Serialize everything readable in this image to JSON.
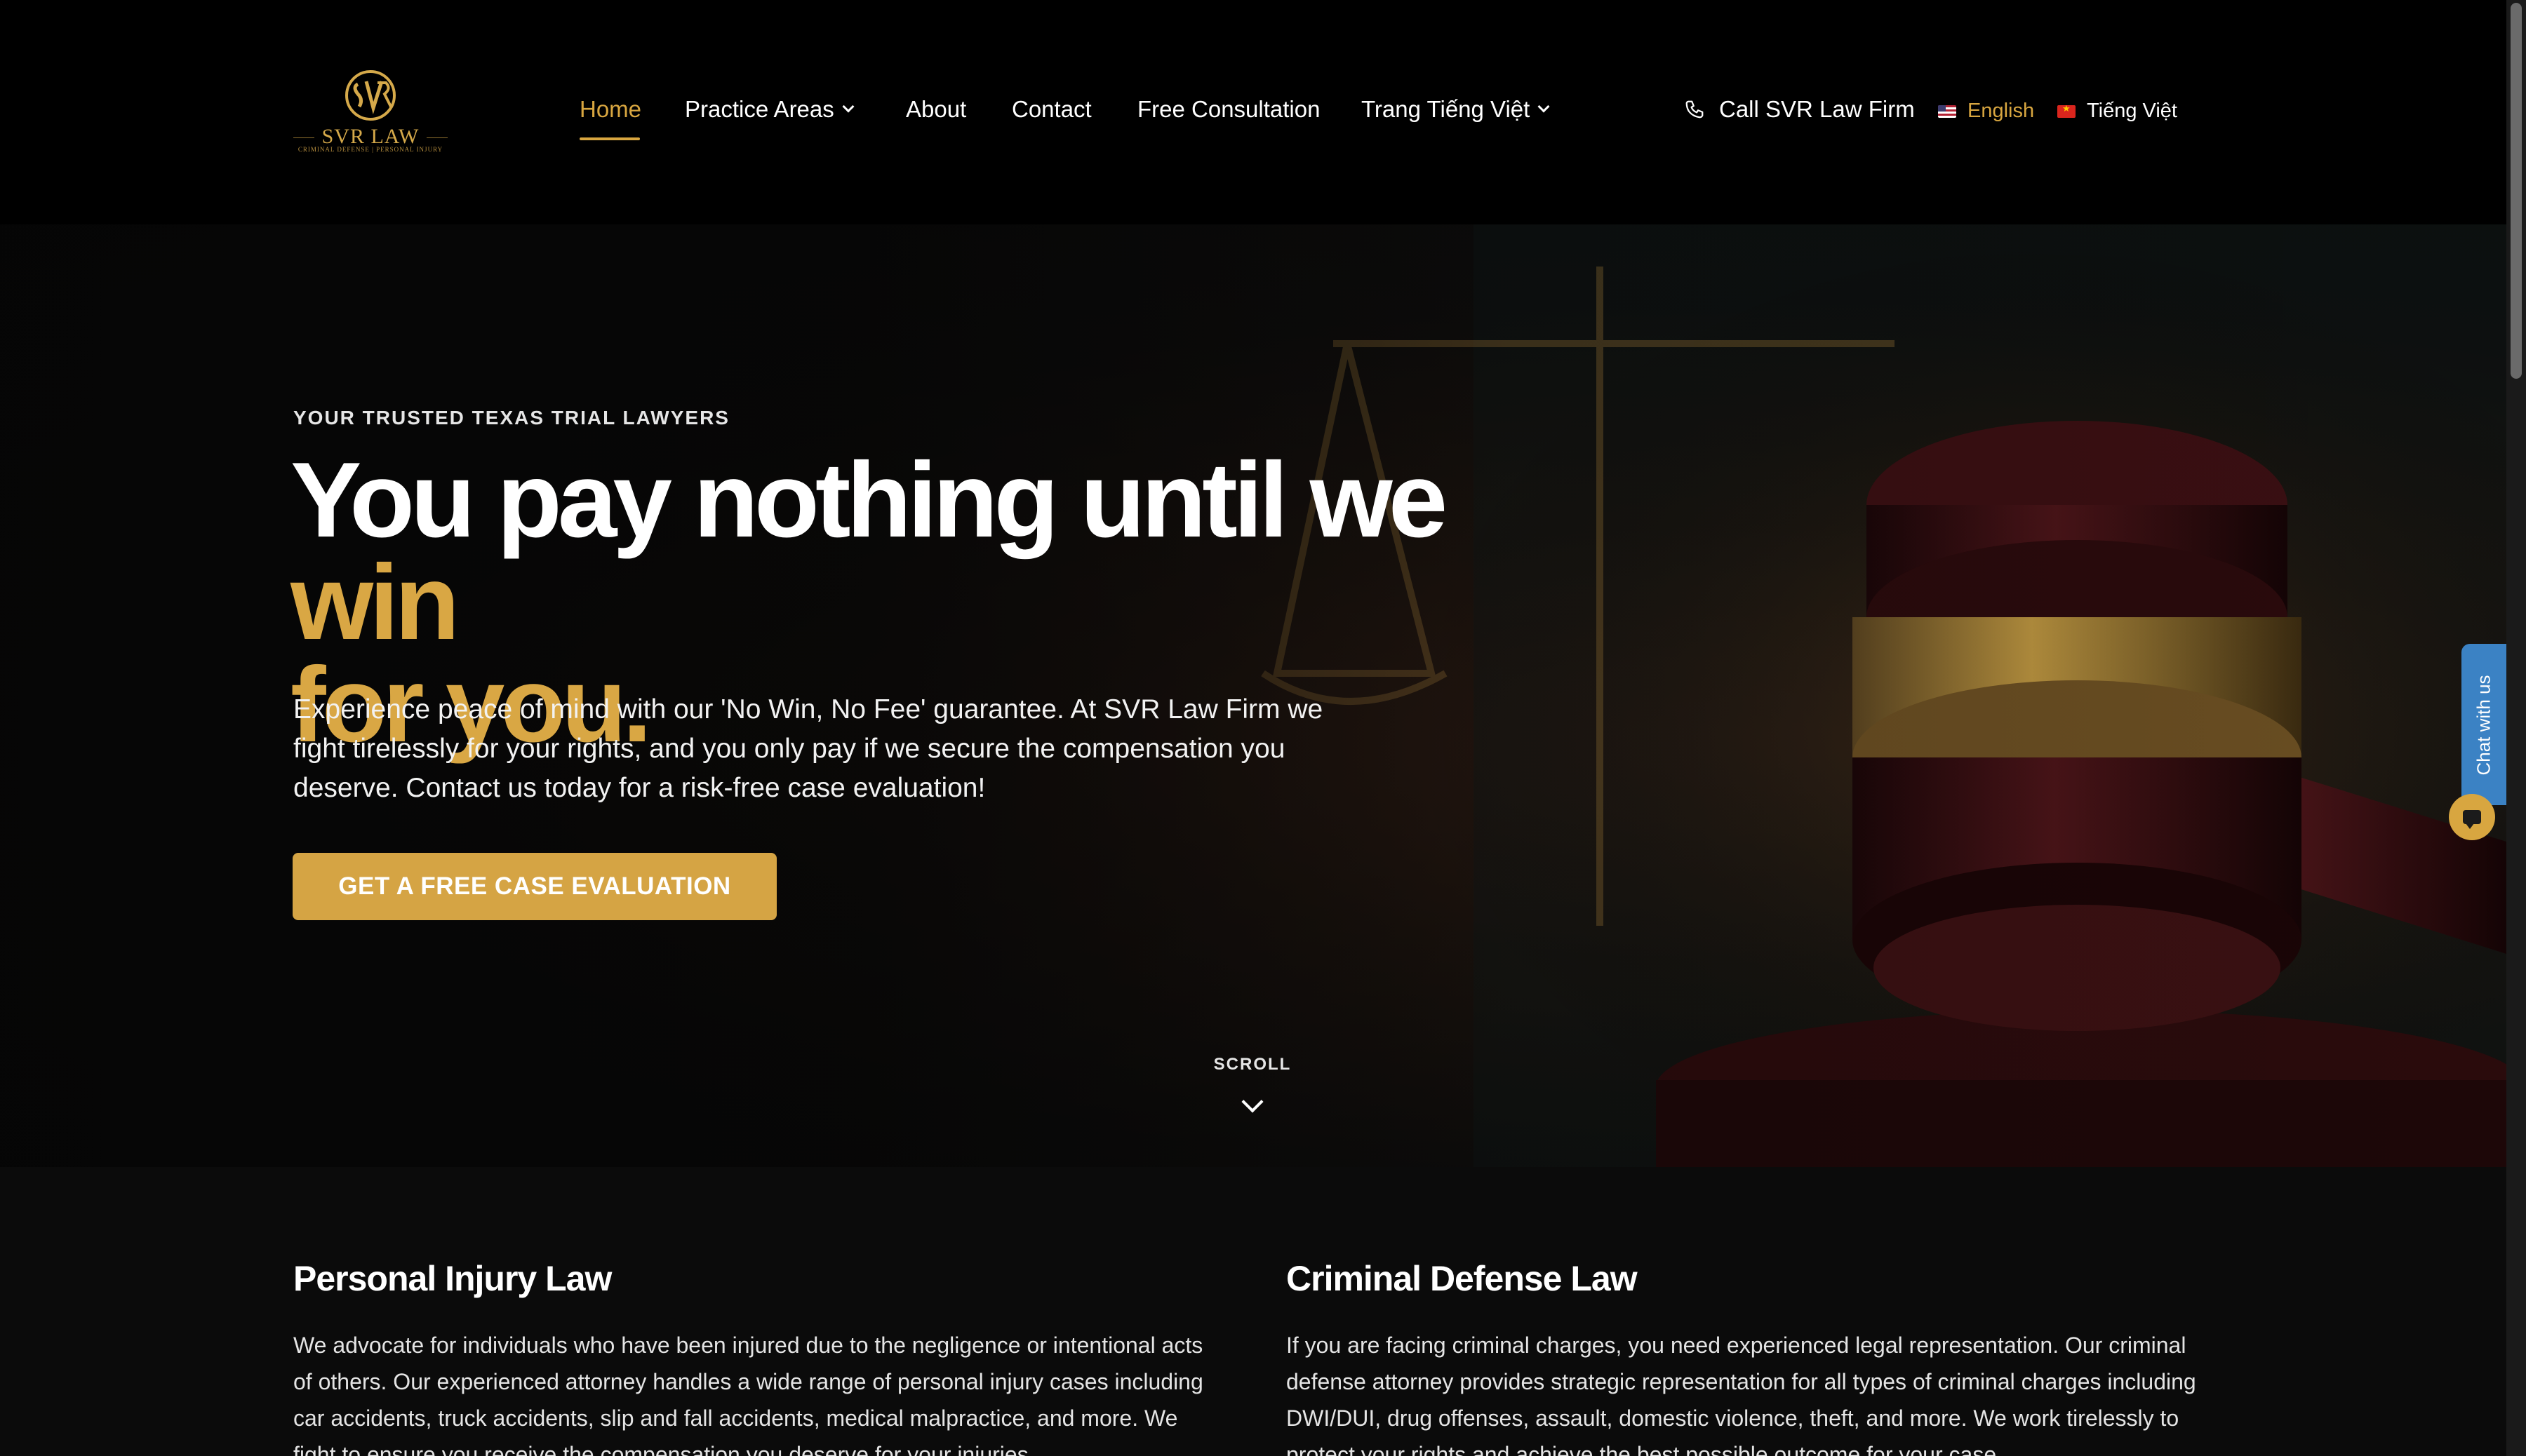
{
  "header": {
    "logo_text": "SVR LAW",
    "logo_tagline": "CRIMINAL DEFENSE | PERSONAL INJURY",
    "nav": [
      {
        "label": "Home",
        "active": true
      },
      {
        "label": "Practice Areas",
        "dropdown": true
      },
      {
        "label": "About"
      },
      {
        "label": "Contact"
      },
      {
        "label": "Free Consultation"
      },
      {
        "label": "Trang Tiếng Việt",
        "dropdown": true
      }
    ],
    "call_label": "Call SVR Law Firm",
    "languages": [
      {
        "label": "English",
        "flag": "flag-us-icon",
        "active": true
      },
      {
        "label": "Tiếng Việt",
        "flag": "flag-vn-icon",
        "active": false
      }
    ]
  },
  "hero": {
    "eyebrow": "YOUR TRUSTED TEXAS TRIAL LAWYERS",
    "headline_white": "You pay nothing until we ",
    "headline_gold_1": "win",
    "headline_gold_2": "for you.",
    "copy": "Experience peace of mind with our 'No Win, No Fee' guarantee. At SVR Law Firm we fight tirelessly for your rights, and you only pay if we secure the compensation you deserve. Contact us today for a risk-free case evaluation!",
    "cta_label": "GET A FREE CASE EVALUATION",
    "scroll_label": "SCROLL"
  },
  "chat": {
    "label": "Chat with us"
  },
  "practice": [
    {
      "title": "Personal Injury Law",
      "body": "We advocate for individuals who have been injured due to the negligence or intentional acts of others. Our experienced attorney handles a wide range of personal injury cases including car accidents, truck accidents, slip and fall accidents, medical malpractice, and more. We fight to ensure you receive the compensation you deserve for your injuries."
    },
    {
      "title": "Criminal Defense Law",
      "body": "If you are facing criminal charges, you need experienced legal representation. Our criminal defense attorney provides strategic representation for all types of criminal charges including DWI/DUI, drug offenses, assault, domestic violence, theft, and more. We work tirelessly to protect your rights and achieve the best possible outcome for your case."
    }
  ],
  "colors": {
    "accent_gold": "#d8a640",
    "background": "#000000",
    "chat_blue": "#3b82c4"
  }
}
